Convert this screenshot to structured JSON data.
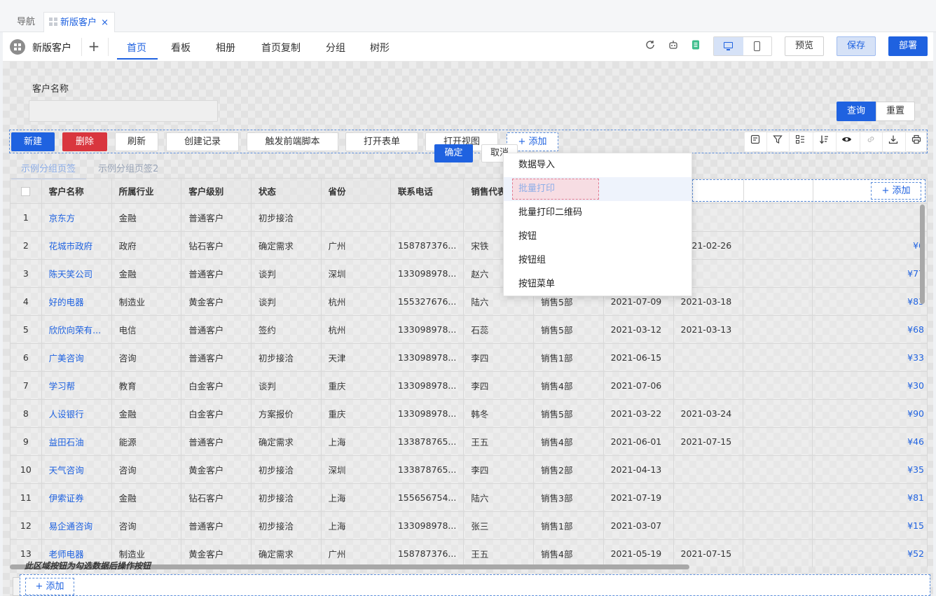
{
  "tabbar": {
    "nav_label": "导航",
    "current_tab": "新版客户",
    "close": "×"
  },
  "header": {
    "app_name": "新版客户",
    "add": "+",
    "pages": [
      "首页",
      "看板",
      "相册",
      "首页复制",
      "分组",
      "树形"
    ],
    "active_page": 0,
    "icons": [
      "refresh-icon",
      "robot-icon",
      "document-icon"
    ],
    "preview": "预览",
    "save": "保存",
    "deploy": "部署"
  },
  "filter": {
    "label": "客户名称",
    "value": "",
    "query": "查询",
    "reset": "重置"
  },
  "actions": {
    "new": "新建",
    "delete": "删除",
    "refresh": "刷新",
    "create_record": "创建记录",
    "trigger_script": "触发前端脚本",
    "open_form": "打开表单",
    "open_view": "打开视图",
    "add": "+ 添加",
    "confirm": "确定",
    "cancel": "取消",
    "tool_icons": [
      "form-icon",
      "filter-icon",
      "columns-icon",
      "sort-icon",
      "eye-icon",
      "link-icon",
      "download-icon",
      "print-icon"
    ]
  },
  "group_tabs": [
    "示例分组页签",
    "示例分组页签2"
  ],
  "dropdown": [
    "数据导入",
    "批量打印",
    "批量打印二维码",
    "按钮",
    "按钮组",
    "按钮菜单"
  ],
  "table": {
    "columns": [
      "客户名称",
      "所属行业",
      "客户级别",
      "状态",
      "省份",
      "联系电话",
      "销售代表"
    ],
    "add_column": "+ 添加",
    "rows": [
      {
        "idx": "1",
        "name": "京东方",
        "industry": "金融",
        "level": "普通客户",
        "status": "初步接洽",
        "province": "",
        "phone": "",
        "rep": "",
        "dept": "",
        "date1": "",
        "date2": "",
        "amt": ""
      },
      {
        "idx": "2",
        "name": "花城市政府",
        "industry": "政府",
        "level": "钻石客户",
        "status": "确定需求",
        "province": "广州",
        "phone": "158787376...",
        "rep": "宋铁",
        "dept": "",
        "date1": "",
        "date2": "2021-02-26",
        "amt": "¥6"
      },
      {
        "idx": "3",
        "name": "陈天笑公司",
        "industry": "金融",
        "level": "普通客户",
        "status": "谈判",
        "province": "深圳",
        "phone": "133098978...",
        "rep": "赵六",
        "dept": "",
        "date1": "",
        "date2": "",
        "amt": "¥77"
      },
      {
        "idx": "4",
        "name": "好的电器",
        "industry": "制造业",
        "level": "黄金客户",
        "status": "谈判",
        "province": "杭州",
        "phone": "155327676...",
        "rep": "陆六",
        "dept": "销售5部",
        "date1": "2021-07-09",
        "date2": "2021-03-18",
        "amt": "¥83"
      },
      {
        "idx": "5",
        "name": "欣欣向荣有...",
        "industry": "电信",
        "level": "普通客户",
        "status": "签约",
        "province": "杭州",
        "phone": "133098978...",
        "rep": "石蕊",
        "dept": "销售5部",
        "date1": "2021-03-12",
        "date2": "2021-03-13",
        "amt": "¥68"
      },
      {
        "idx": "6",
        "name": "广美咨询",
        "industry": "咨询",
        "level": "普通客户",
        "status": "初步接洽",
        "province": "天津",
        "phone": "133098978...",
        "rep": "李四",
        "dept": "销售1部",
        "date1": "2021-06-15",
        "date2": "",
        "amt": "¥33"
      },
      {
        "idx": "7",
        "name": "学习帮",
        "industry": "教育",
        "level": "白金客户",
        "status": "谈判",
        "province": "重庆",
        "phone": "133098978...",
        "rep": "李四",
        "dept": "销售4部",
        "date1": "2021-07-06",
        "date2": "",
        "amt": "¥30"
      },
      {
        "idx": "8",
        "name": "人设银行",
        "industry": "金融",
        "level": "白金客户",
        "status": "方案报价",
        "province": "重庆",
        "phone": "133098978...",
        "rep": "韩冬",
        "dept": "销售5部",
        "date1": "2021-03-22",
        "date2": "2021-03-24",
        "amt": "¥90"
      },
      {
        "idx": "9",
        "name": "益田石油",
        "industry": "能源",
        "level": "普通客户",
        "status": "确定需求",
        "province": "上海",
        "phone": "133878765...",
        "rep": "王五",
        "dept": "销售4部",
        "date1": "2021-06-01",
        "date2": "2021-07-15",
        "amt": "¥46"
      },
      {
        "idx": "10",
        "name": "天气咨询",
        "industry": "咨询",
        "level": "黄金客户",
        "status": "初步接洽",
        "province": "深圳",
        "phone": "133878765...",
        "rep": "李四",
        "dept": "销售2部",
        "date1": "2021-04-13",
        "date2": "",
        "amt": "¥35"
      },
      {
        "idx": "11",
        "name": "伊索证券",
        "industry": "金融",
        "level": "钻石客户",
        "status": "初步接洽",
        "province": "上海",
        "phone": "155656754...",
        "rep": "陆六",
        "dept": "销售3部",
        "date1": "2021-07-19",
        "date2": "",
        "amt": "¥81"
      },
      {
        "idx": "12",
        "name": "易企通咨询",
        "industry": "咨询",
        "level": "普通客户",
        "status": "初步接洽",
        "province": "上海",
        "phone": "133098978...",
        "rep": "张三",
        "dept": "销售1部",
        "date1": "2021-03-07",
        "date2": "",
        "amt": "¥15"
      },
      {
        "idx": "13",
        "name": "老师电器",
        "industry": "制造业",
        "level": "黄金客户",
        "status": "确定需求",
        "province": "广州",
        "phone": "158787376...",
        "rep": "王五",
        "dept": "销售4部",
        "date1": "2021-05-19",
        "date2": "2021-07-15",
        "amt": "¥52"
      }
    ]
  },
  "batch_note": "此区域按钮为勾选数据后操作按钮",
  "bottom": {
    "add": "+ 添加"
  }
}
